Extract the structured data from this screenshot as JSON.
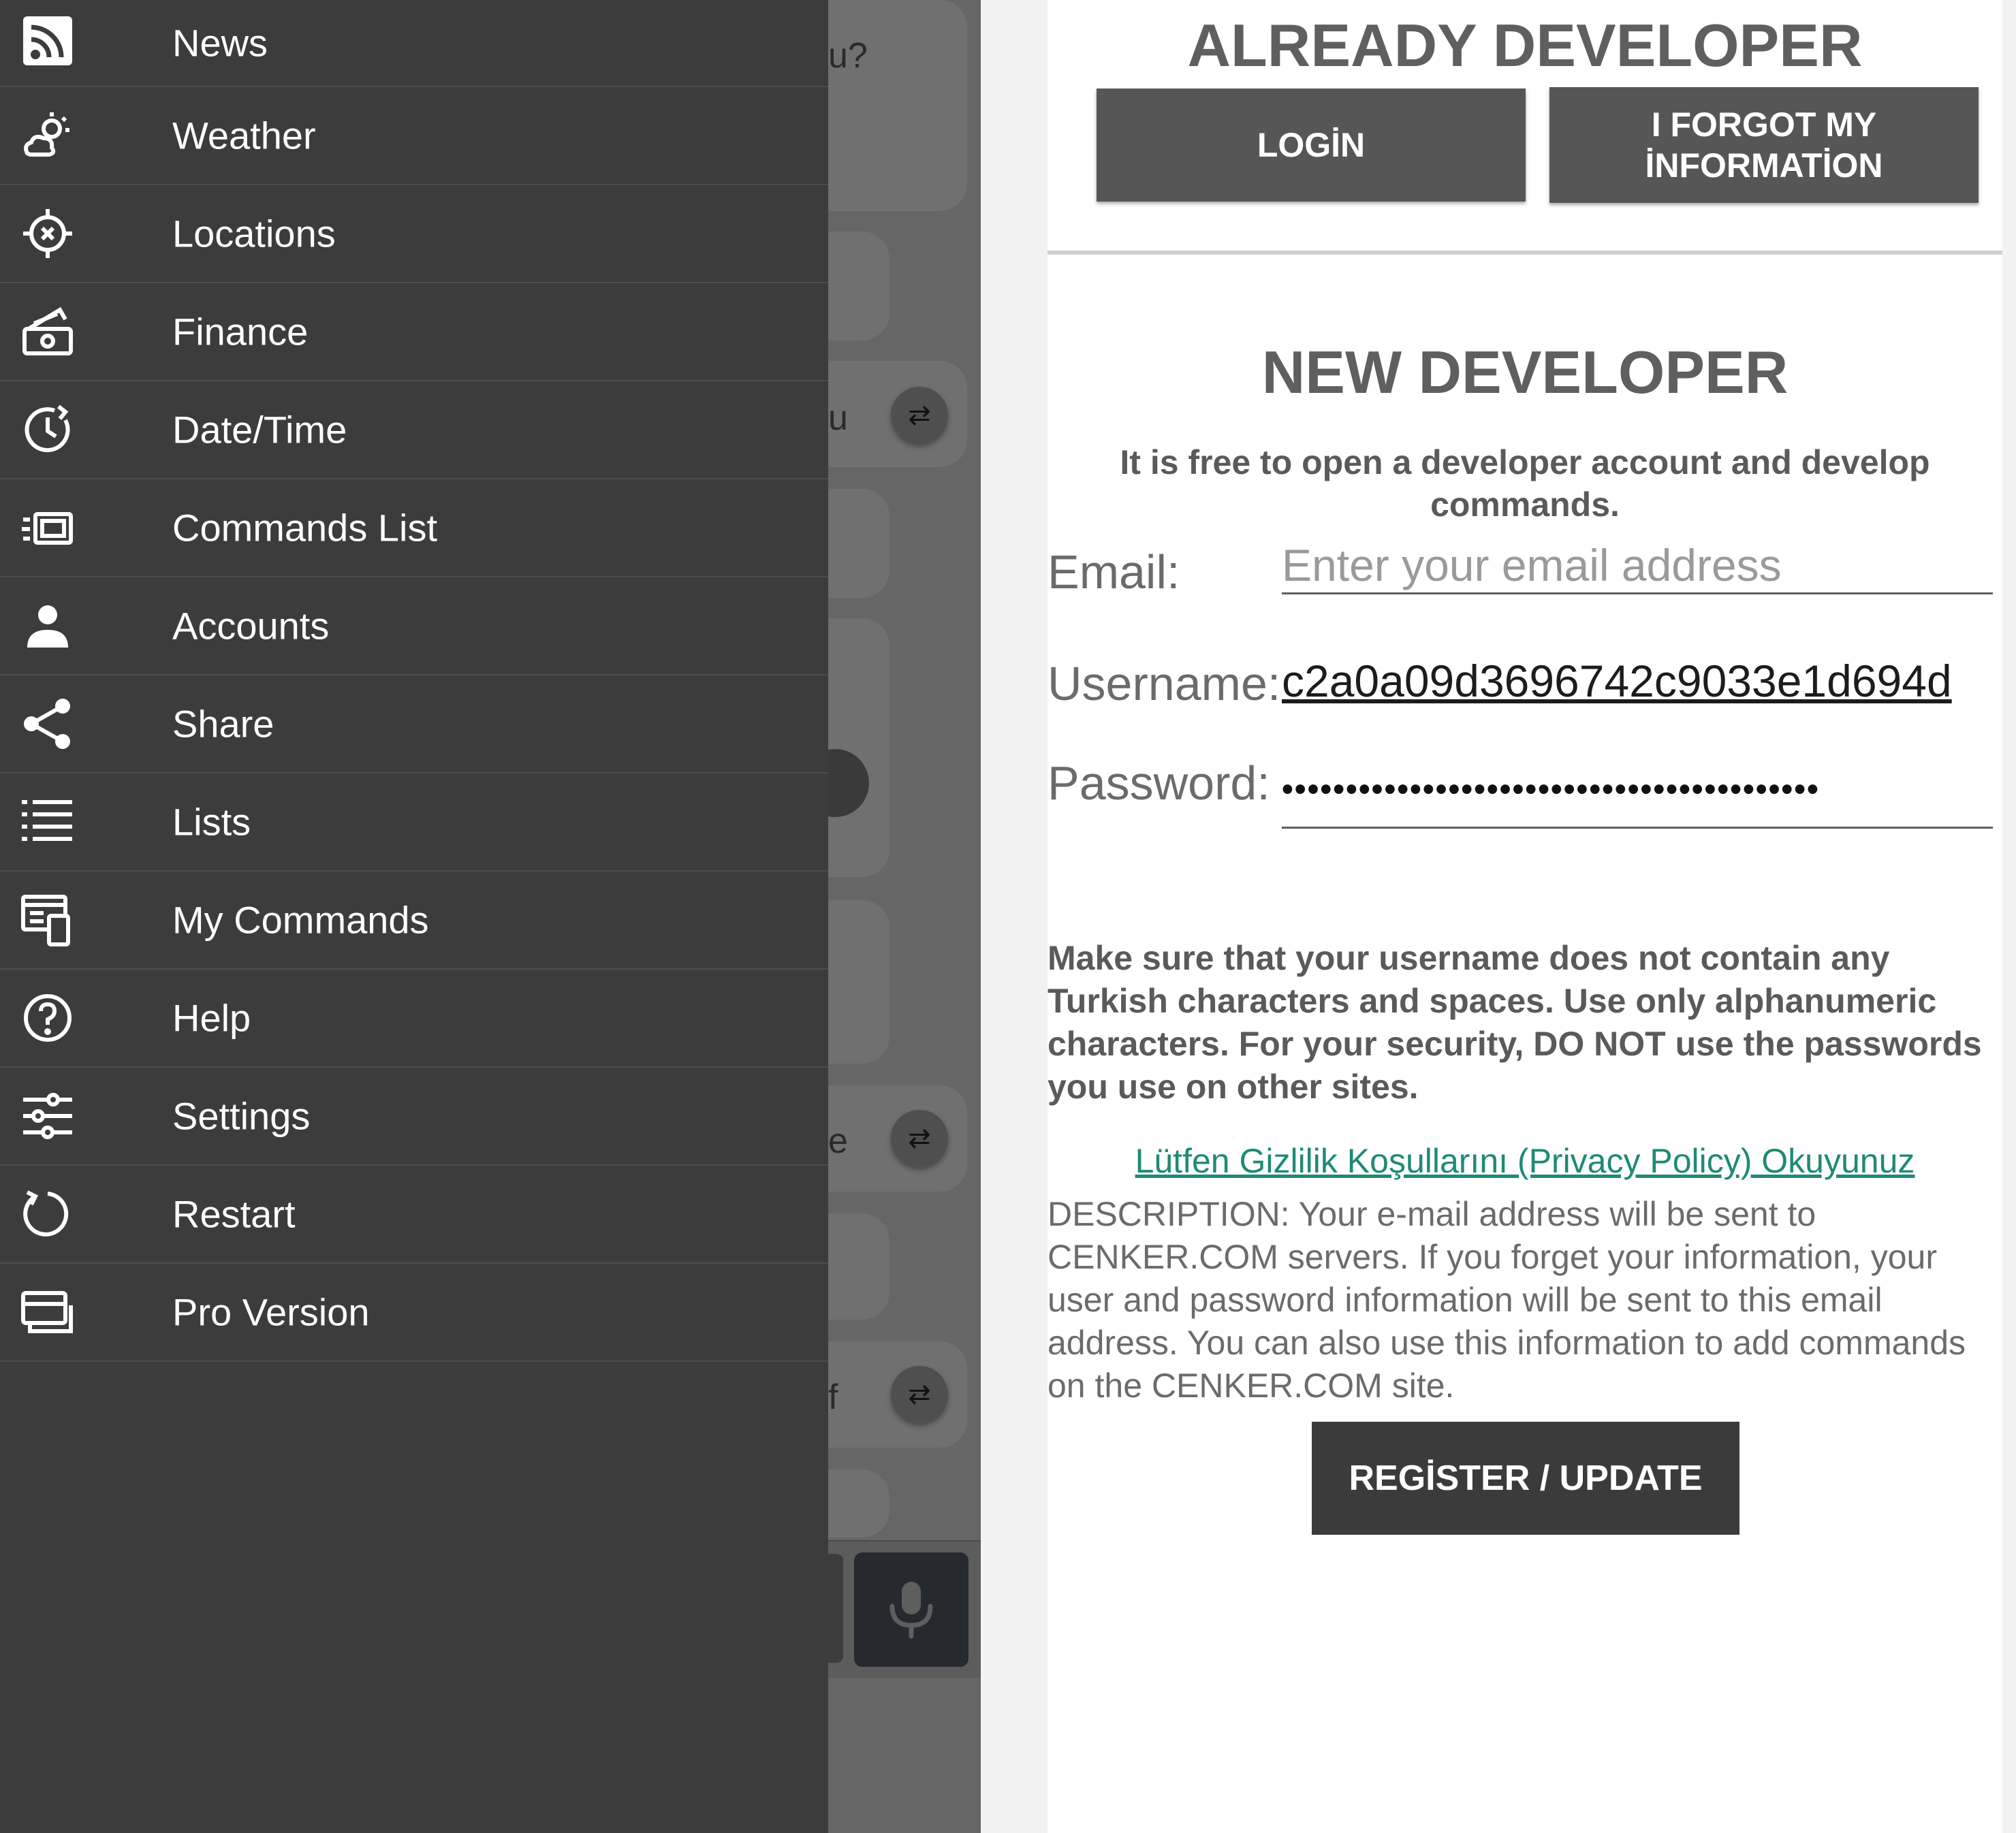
{
  "drawer": {
    "items": [
      {
        "label": "News",
        "icon": "rss-icon"
      },
      {
        "label": "Weather",
        "icon": "weather-icon"
      },
      {
        "label": "Locations",
        "icon": "location-target-icon"
      },
      {
        "label": "Finance",
        "icon": "money-icon"
      },
      {
        "label": "Date/Time",
        "icon": "clock-icon"
      },
      {
        "label": "Commands List",
        "icon": "commands-list-icon"
      },
      {
        "label": "Accounts",
        "icon": "person-icon"
      },
      {
        "label": "Share",
        "icon": "share-icon"
      },
      {
        "label": "Lists",
        "icon": "list-icon"
      },
      {
        "label": "My Commands",
        "icon": "my-commands-icon"
      },
      {
        "label": "Help",
        "icon": "help-icon"
      },
      {
        "label": "Settings",
        "icon": "sliders-icon"
      },
      {
        "label": "Restart",
        "icon": "restart-icon"
      },
      {
        "label": "Pro Version",
        "icon": "pro-version-icon"
      }
    ]
  },
  "chat": {
    "fragments": [
      "u?",
      "u",
      "e",
      "f"
    ]
  },
  "developer": {
    "already_title": "ALREADY DEVELOPER",
    "login_label": "LOGİN",
    "forgot_line1": "I FORGOT MY",
    "forgot_line2": "İNFORMATİON",
    "new_title": "NEW DEVELOPER",
    "free_text": "It is free to open a developer account and develop commands.",
    "email_label": "Email:",
    "email_placeholder": "Enter your email address",
    "username_label": "Username:",
    "username_value": "c2a0a09d3696742c9033e1d694d",
    "password_label": "Password:",
    "password_value": "••••••••••••••••••••••••••••••••••••••••••",
    "warning_text": "Make sure that your username does not contain any Turkish characters and spaces. Use only alphanumeric characters. For your security, DO NOT use the passwords you use on other sites.",
    "privacy_link": "Lütfen Gizlilik Koşullarını (Privacy Policy) Okuyunuz",
    "description_text": "DESCRIPTION: Your e-mail address will be sent to CENKER.COM servers. If you forget your information, your user and password information will be sent to this email address. You can also use this information to add commands on the CENKER.COM site.",
    "register_label": "REGİSTER / UPDATE"
  }
}
